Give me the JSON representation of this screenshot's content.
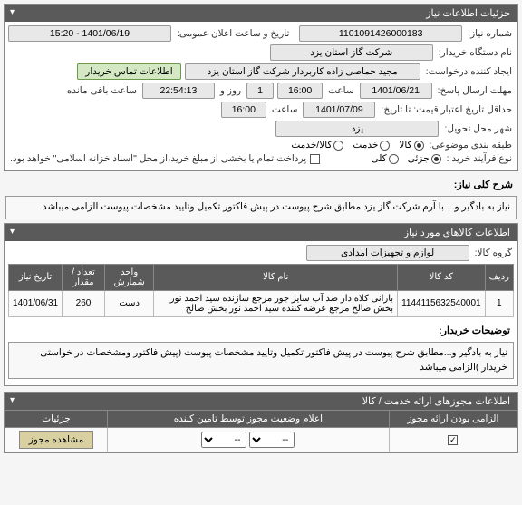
{
  "panels": {
    "details": {
      "title": "جزئیات اطلاعات نیاز",
      "fields": {
        "need_no_label": "شماره نیاز:",
        "need_no": "1101091426000183",
        "announce_date_label": "تاریخ و ساعت اعلان عمومی:",
        "announce_date": "1401/06/19 - 15:20",
        "buyer_label": "نام دستگاه خریدار:",
        "buyer": "شرکت گاز استان یزد",
        "requester_label": "ایجاد کننده درخواست:",
        "requester": "مجید حماصی زاده کاربردار شرکت گاز استان یزد",
        "contact_btn": "اطلاعات تماس خریدار",
        "deadline_label": "مهلت ارسال پاسخ:",
        "deadline_date": "1401/06/21",
        "time_label": "ساعت",
        "deadline_time": "16:00",
        "day_label": "روز و",
        "day_value": "1",
        "remain_time": "22:54:13",
        "remain_label": "ساعت باقی مانده",
        "valid_label": "حداقل تاریخ اعتبار قیمت: تا تاریخ:",
        "valid_date": "1401/07/09",
        "valid_time": "16:00",
        "deliver_city_label": "شهر محل تحویل:",
        "deliver_city": "یزد",
        "category_label": "طبقه بندی موضوعی:",
        "commodity": "کالا",
        "service": "خدمت",
        "both": "کالا/خدمت",
        "purchase_type_label": "نوع فرآیند خرید :",
        "partial": "جزئی",
        "full": "کلی",
        "purchase_note": "پرداخت تمام یا بخشی از مبلغ خرید،از محل \"اسناد خزانه اسلامی\" خواهد بود."
      }
    },
    "summary": {
      "title": "شرح کلی نیاز:",
      "text": "نیاز به بادگیر و... با آرم شرکت گاز یزد مطابق شرح پیوست در پیش فاکتور تکمیل وتایید مشخصات پیوست الزامی میباشد"
    },
    "goods": {
      "title": "اطلاعات کالاهای مورد نیاز",
      "group_label": "گروه کالا:",
      "group_value": "لوازم و تجهیزات امدادی",
      "columns": {
        "row": "ردیف",
        "code": "کد کالا",
        "name": "نام کالا",
        "unit": "واحد شمارش",
        "qty": "تعداد / مقدار",
        "date": "تاریخ نیاز"
      },
      "rows": [
        {
          "row": "1",
          "code": "1144115632540001",
          "name": "بارانی کلاه دار ضد آب سایز جور مرجع سازنده سید احمد نور بخش صالح مرجع عرضه کننده سید احمد نور بخش صالح",
          "unit": "دست",
          "qty": "260",
          "date": "1401/06/31"
        }
      ],
      "buyer_notes_label": "توضیحات خریدار:",
      "buyer_notes": "نیاز به بادگیر و...مطابق شرح پیوست در پیش فاکتور تکمیل وتایید مشخصات پیوست (پیش فاکتور ومشخصات در خواستی خریدار )الزامی میباشد"
    },
    "auth": {
      "title": "اطلاعات مجوزهای ارائه خدمت / کالا",
      "columns": {
        "required": "الزامی بودن ارائه مجوز",
        "status": "اعلام وضعیت مجوز توسط تامین کننده",
        "details": "جزئیات"
      },
      "select_placeholder": "--",
      "view_btn": "مشاهده مجوز"
    }
  }
}
